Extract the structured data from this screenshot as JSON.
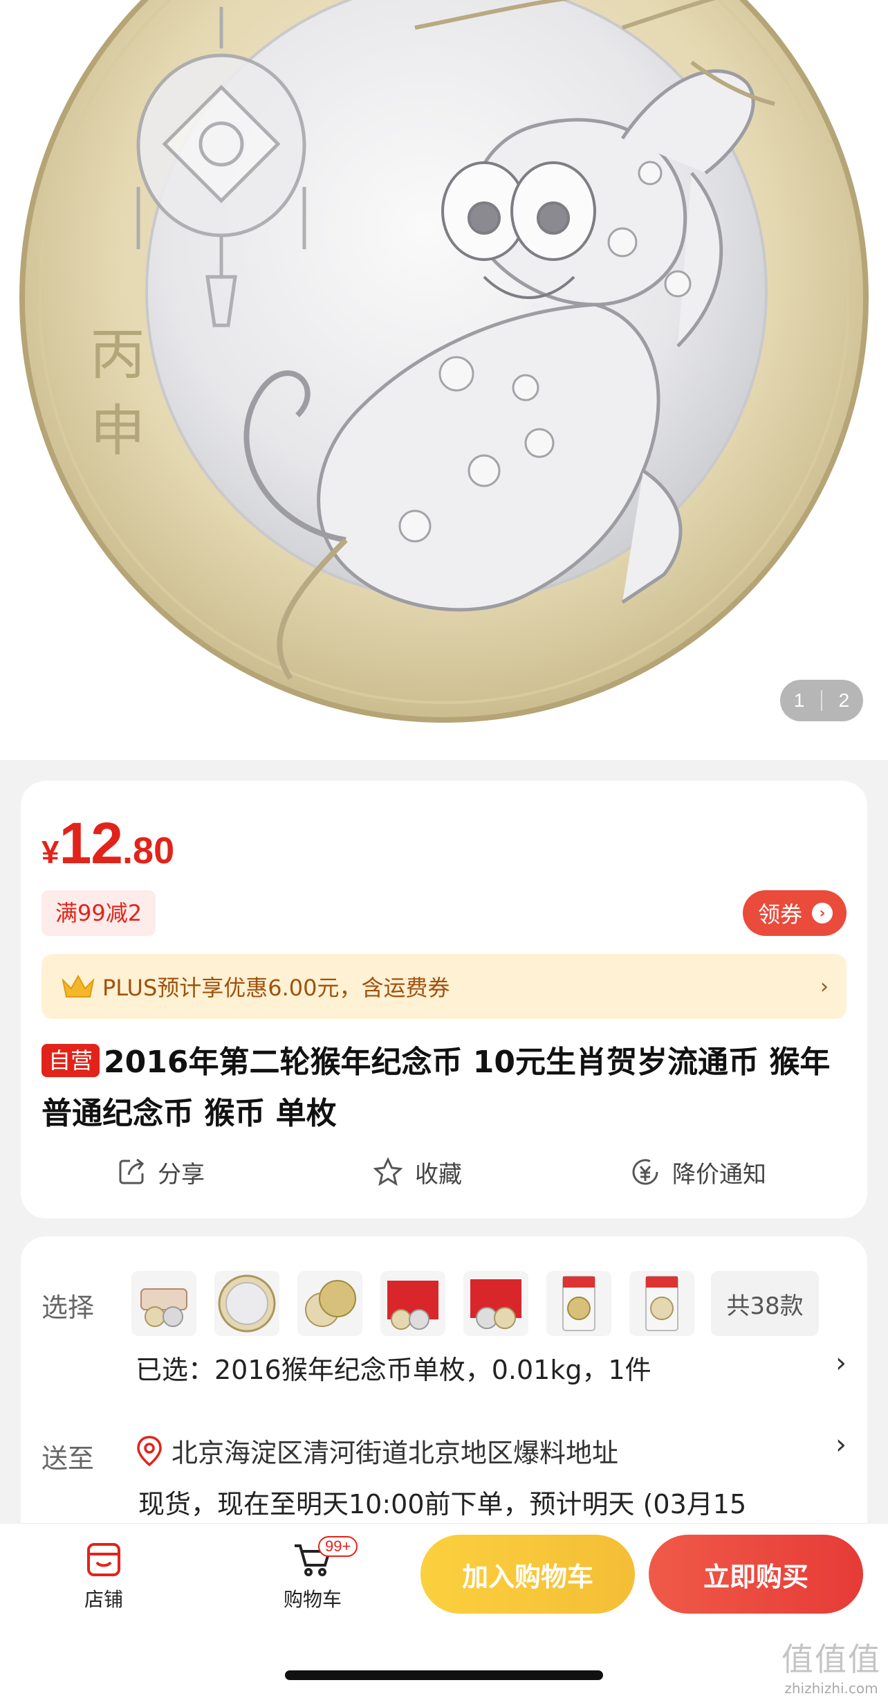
{
  "gallery": {
    "current_page": "1",
    "total_pages": "2",
    "coin_legend_chars": [
      "丙",
      "申"
    ]
  },
  "price": {
    "currency": "¥",
    "integer": "12",
    "decimal": ".80",
    "color": "#e2231a"
  },
  "promo": {
    "tag": "满99减2",
    "coupon_label": "领券"
  },
  "plus": {
    "text": "PLUS预计享优惠6.00元，含运费券",
    "chevron": "›"
  },
  "product": {
    "self_operated": "自营",
    "title": "2016年第二轮猴年纪念币 10元生肖贺岁流通币 猴年普通纪念币 猴币 单枚"
  },
  "actions": {
    "share": "分享",
    "favorite": "收藏",
    "price_alert": "降价通知"
  },
  "options": {
    "label": "选择",
    "more": "共38款",
    "selected": "已选：2016猴年纪念币单枚，0.01kg，1件",
    "thumbnails": [
      "coin-roll",
      "monkey-coin",
      "coin-pair",
      "red-envelope-pack-a",
      "red-envelope-pack-b",
      "graded-slab-a",
      "graded-slab-b"
    ]
  },
  "delivery": {
    "label": "送至",
    "address": "北京海淀区清河街道北京地区爆料地址",
    "stock_info": "现货，现在至明天10:00前下单，预计明天 (03月15"
  },
  "bottom_bar": {
    "shop": "店铺",
    "cart": "购物车",
    "cart_badge": "99+",
    "add_to_cart": "加入购物车",
    "buy_now": "立即购买"
  },
  "watermark": {
    "big": "值值值",
    "small": "zhizhizhi.com"
  },
  "colors": {
    "accent_red": "#e2231a",
    "plus_gold": "#a0520e",
    "cart_yellow": "#f4be36",
    "buy_red": "#e63b37"
  }
}
